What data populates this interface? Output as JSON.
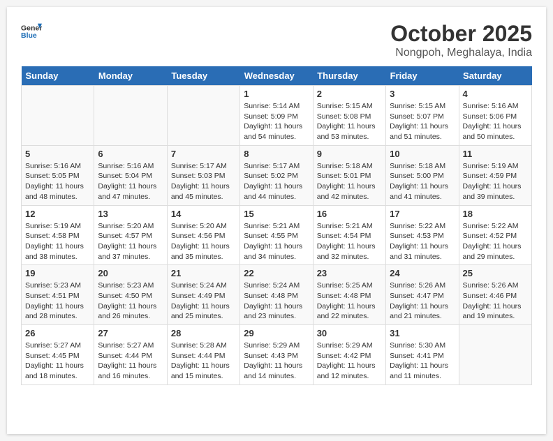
{
  "header": {
    "logo_line1": "General",
    "logo_line2": "Blue",
    "month": "October 2025",
    "location": "Nongpoh, Meghalaya, India"
  },
  "weekdays": [
    "Sunday",
    "Monday",
    "Tuesday",
    "Wednesday",
    "Thursday",
    "Friday",
    "Saturday"
  ],
  "weeks": [
    [
      {
        "day": "",
        "sunrise": "",
        "sunset": "",
        "daylight": ""
      },
      {
        "day": "",
        "sunrise": "",
        "sunset": "",
        "daylight": ""
      },
      {
        "day": "",
        "sunrise": "",
        "sunset": "",
        "daylight": ""
      },
      {
        "day": "1",
        "sunrise": "Sunrise: 5:14 AM",
        "sunset": "Sunset: 5:09 PM",
        "daylight": "Daylight: 11 hours and 54 minutes."
      },
      {
        "day": "2",
        "sunrise": "Sunrise: 5:15 AM",
        "sunset": "Sunset: 5:08 PM",
        "daylight": "Daylight: 11 hours and 53 minutes."
      },
      {
        "day": "3",
        "sunrise": "Sunrise: 5:15 AM",
        "sunset": "Sunset: 5:07 PM",
        "daylight": "Daylight: 11 hours and 51 minutes."
      },
      {
        "day": "4",
        "sunrise": "Sunrise: 5:16 AM",
        "sunset": "Sunset: 5:06 PM",
        "daylight": "Daylight: 11 hours and 50 minutes."
      }
    ],
    [
      {
        "day": "5",
        "sunrise": "Sunrise: 5:16 AM",
        "sunset": "Sunset: 5:05 PM",
        "daylight": "Daylight: 11 hours and 48 minutes."
      },
      {
        "day": "6",
        "sunrise": "Sunrise: 5:16 AM",
        "sunset": "Sunset: 5:04 PM",
        "daylight": "Daylight: 11 hours and 47 minutes."
      },
      {
        "day": "7",
        "sunrise": "Sunrise: 5:17 AM",
        "sunset": "Sunset: 5:03 PM",
        "daylight": "Daylight: 11 hours and 45 minutes."
      },
      {
        "day": "8",
        "sunrise": "Sunrise: 5:17 AM",
        "sunset": "Sunset: 5:02 PM",
        "daylight": "Daylight: 11 hours and 44 minutes."
      },
      {
        "day": "9",
        "sunrise": "Sunrise: 5:18 AM",
        "sunset": "Sunset: 5:01 PM",
        "daylight": "Daylight: 11 hours and 42 minutes."
      },
      {
        "day": "10",
        "sunrise": "Sunrise: 5:18 AM",
        "sunset": "Sunset: 5:00 PM",
        "daylight": "Daylight: 11 hours and 41 minutes."
      },
      {
        "day": "11",
        "sunrise": "Sunrise: 5:19 AM",
        "sunset": "Sunset: 4:59 PM",
        "daylight": "Daylight: 11 hours and 39 minutes."
      }
    ],
    [
      {
        "day": "12",
        "sunrise": "Sunrise: 5:19 AM",
        "sunset": "Sunset: 4:58 PM",
        "daylight": "Daylight: 11 hours and 38 minutes."
      },
      {
        "day": "13",
        "sunrise": "Sunrise: 5:20 AM",
        "sunset": "Sunset: 4:57 PM",
        "daylight": "Daylight: 11 hours and 37 minutes."
      },
      {
        "day": "14",
        "sunrise": "Sunrise: 5:20 AM",
        "sunset": "Sunset: 4:56 PM",
        "daylight": "Daylight: 11 hours and 35 minutes."
      },
      {
        "day": "15",
        "sunrise": "Sunrise: 5:21 AM",
        "sunset": "Sunset: 4:55 PM",
        "daylight": "Daylight: 11 hours and 34 minutes."
      },
      {
        "day": "16",
        "sunrise": "Sunrise: 5:21 AM",
        "sunset": "Sunset: 4:54 PM",
        "daylight": "Daylight: 11 hours and 32 minutes."
      },
      {
        "day": "17",
        "sunrise": "Sunrise: 5:22 AM",
        "sunset": "Sunset: 4:53 PM",
        "daylight": "Daylight: 11 hours and 31 minutes."
      },
      {
        "day": "18",
        "sunrise": "Sunrise: 5:22 AM",
        "sunset": "Sunset: 4:52 PM",
        "daylight": "Daylight: 11 hours and 29 minutes."
      }
    ],
    [
      {
        "day": "19",
        "sunrise": "Sunrise: 5:23 AM",
        "sunset": "Sunset: 4:51 PM",
        "daylight": "Daylight: 11 hours and 28 minutes."
      },
      {
        "day": "20",
        "sunrise": "Sunrise: 5:23 AM",
        "sunset": "Sunset: 4:50 PM",
        "daylight": "Daylight: 11 hours and 26 minutes."
      },
      {
        "day": "21",
        "sunrise": "Sunrise: 5:24 AM",
        "sunset": "Sunset: 4:49 PM",
        "daylight": "Daylight: 11 hours and 25 minutes."
      },
      {
        "day": "22",
        "sunrise": "Sunrise: 5:24 AM",
        "sunset": "Sunset: 4:48 PM",
        "daylight": "Daylight: 11 hours and 23 minutes."
      },
      {
        "day": "23",
        "sunrise": "Sunrise: 5:25 AM",
        "sunset": "Sunset: 4:48 PM",
        "daylight": "Daylight: 11 hours and 22 minutes."
      },
      {
        "day": "24",
        "sunrise": "Sunrise: 5:26 AM",
        "sunset": "Sunset: 4:47 PM",
        "daylight": "Daylight: 11 hours and 21 minutes."
      },
      {
        "day": "25",
        "sunrise": "Sunrise: 5:26 AM",
        "sunset": "Sunset: 4:46 PM",
        "daylight": "Daylight: 11 hours and 19 minutes."
      }
    ],
    [
      {
        "day": "26",
        "sunrise": "Sunrise: 5:27 AM",
        "sunset": "Sunset: 4:45 PM",
        "daylight": "Daylight: 11 hours and 18 minutes."
      },
      {
        "day": "27",
        "sunrise": "Sunrise: 5:27 AM",
        "sunset": "Sunset: 4:44 PM",
        "daylight": "Daylight: 11 hours and 16 minutes."
      },
      {
        "day": "28",
        "sunrise": "Sunrise: 5:28 AM",
        "sunset": "Sunset: 4:44 PM",
        "daylight": "Daylight: 11 hours and 15 minutes."
      },
      {
        "day": "29",
        "sunrise": "Sunrise: 5:29 AM",
        "sunset": "Sunset: 4:43 PM",
        "daylight": "Daylight: 11 hours and 14 minutes."
      },
      {
        "day": "30",
        "sunrise": "Sunrise: 5:29 AM",
        "sunset": "Sunset: 4:42 PM",
        "daylight": "Daylight: 11 hours and 12 minutes."
      },
      {
        "day": "31",
        "sunrise": "Sunrise: 5:30 AM",
        "sunset": "Sunset: 4:41 PM",
        "daylight": "Daylight: 11 hours and 11 minutes."
      },
      {
        "day": "",
        "sunrise": "",
        "sunset": "",
        "daylight": ""
      }
    ]
  ]
}
